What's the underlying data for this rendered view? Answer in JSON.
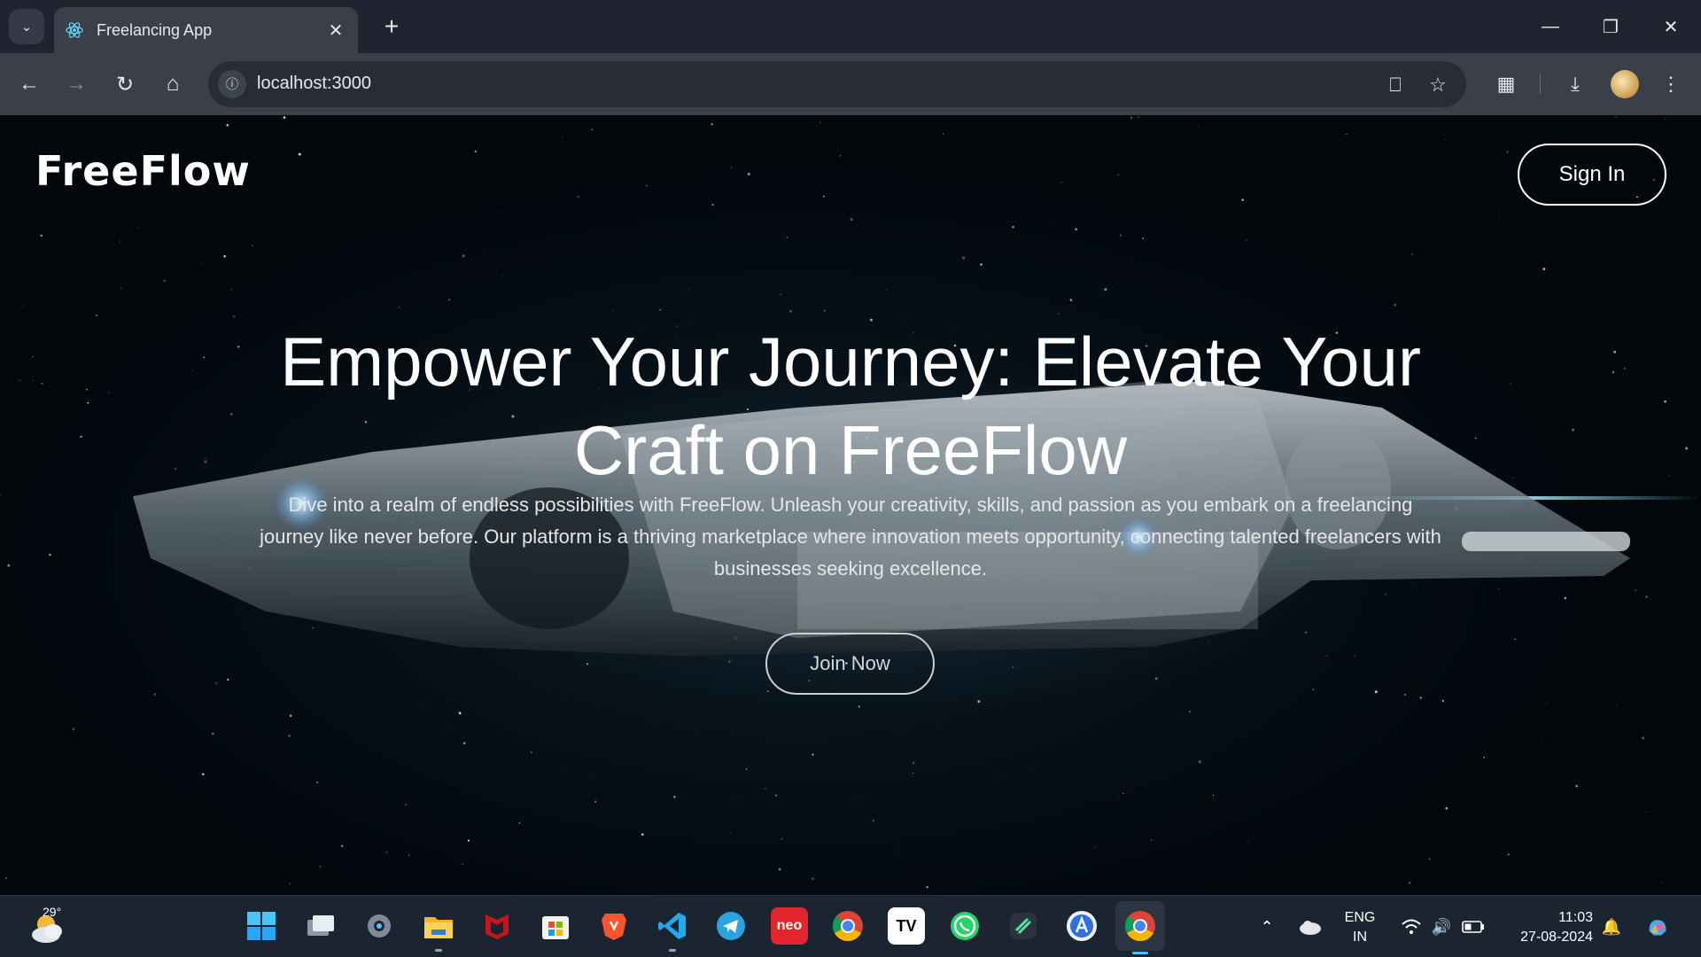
{
  "browser": {
    "tab": {
      "title": "Freelancing App",
      "favicon": "react-atom-icon"
    },
    "new_tab_symbol": "+",
    "url": "localhost:3000"
  },
  "page": {
    "logo": "FreeFlow",
    "sign_in_label": "Sign In",
    "hero_title": "Empower Your Journey: Elevate Your Craft on FreeFlow",
    "hero_description": "Dive into a realm of endless possibilities with FreeFlow. Unleash your creativity, skills, and passion as you embark on a freelancing journey like never before. Our platform is a thriving marketplace where innovation meets opportunity, connecting talented freelancers with businesses seeking excellence.",
    "join_label": "Join Now"
  },
  "taskbar": {
    "weather_temp": "29°",
    "apps": [
      "windows-start-icon",
      "task-view-icon",
      "settings-icon",
      "file-explorer-icon",
      "mcafee-icon",
      "microsoft-store-icon",
      "brave-icon",
      "vscode-icon",
      "telegram-icon",
      "neo-icon",
      "chrome-icon",
      "tradingview-icon",
      "whatsapp-icon",
      "linear-icon",
      "app-store-icon",
      "chrome-active-icon"
    ],
    "lang_line1": "ENG",
    "lang_line2": "IN",
    "time": "11:03",
    "date": "27-08-2024"
  },
  "colors": {
    "chrome_dark": "#1f2430",
    "chrome_mid": "#3b3f4a",
    "taskbar": "#1b2431",
    "accent": "#4cc2ff"
  }
}
